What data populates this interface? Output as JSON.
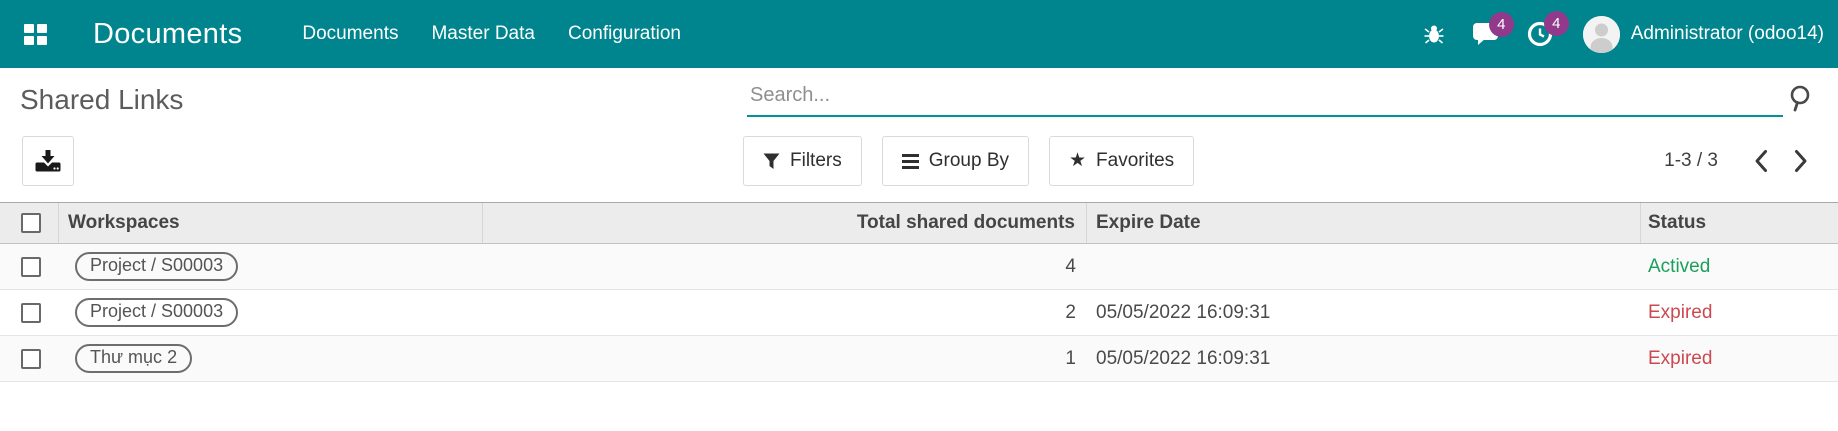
{
  "colors": {
    "navbar_teal": "#00848D",
    "search_underline": "#0191A0",
    "notification_badge": "#913A8C",
    "status_actived": "#1AA05A",
    "status_expired": "#CB4950"
  },
  "navbar": {
    "brand": "Documents",
    "menu": [
      {
        "label": "Documents"
      },
      {
        "label": "Master Data"
      },
      {
        "label": "Configuration"
      }
    ],
    "messages_count": "4",
    "activities_count": "4",
    "user": "Administrator (odoo14)"
  },
  "control_panel": {
    "title": "Shared Links",
    "search_placeholder": "Search...",
    "buttons": {
      "filters": "Filters",
      "group_by": "Group By",
      "favorites": "Favorites"
    },
    "icons": {
      "star_glyph": "★"
    },
    "pager": {
      "range": "1-3 / 3"
    }
  },
  "table": {
    "headers": {
      "workspaces": "Workspaces",
      "total": "Total shared documents",
      "expire": "Expire Date",
      "status": "Status"
    },
    "rows": [
      {
        "workspace": "Project / S00003",
        "total": "4",
        "expire": "",
        "status": "Actived",
        "status_class": "green"
      },
      {
        "workspace": "Project / S00003",
        "total": "2",
        "expire": "05/05/2022 16:09:31",
        "status": "Expired",
        "status_class": "red"
      },
      {
        "workspace": "Thư mục 2",
        "total": "1",
        "expire": "05/05/2022 16:09:31",
        "status": "Expired",
        "status_class": "red"
      }
    ]
  }
}
